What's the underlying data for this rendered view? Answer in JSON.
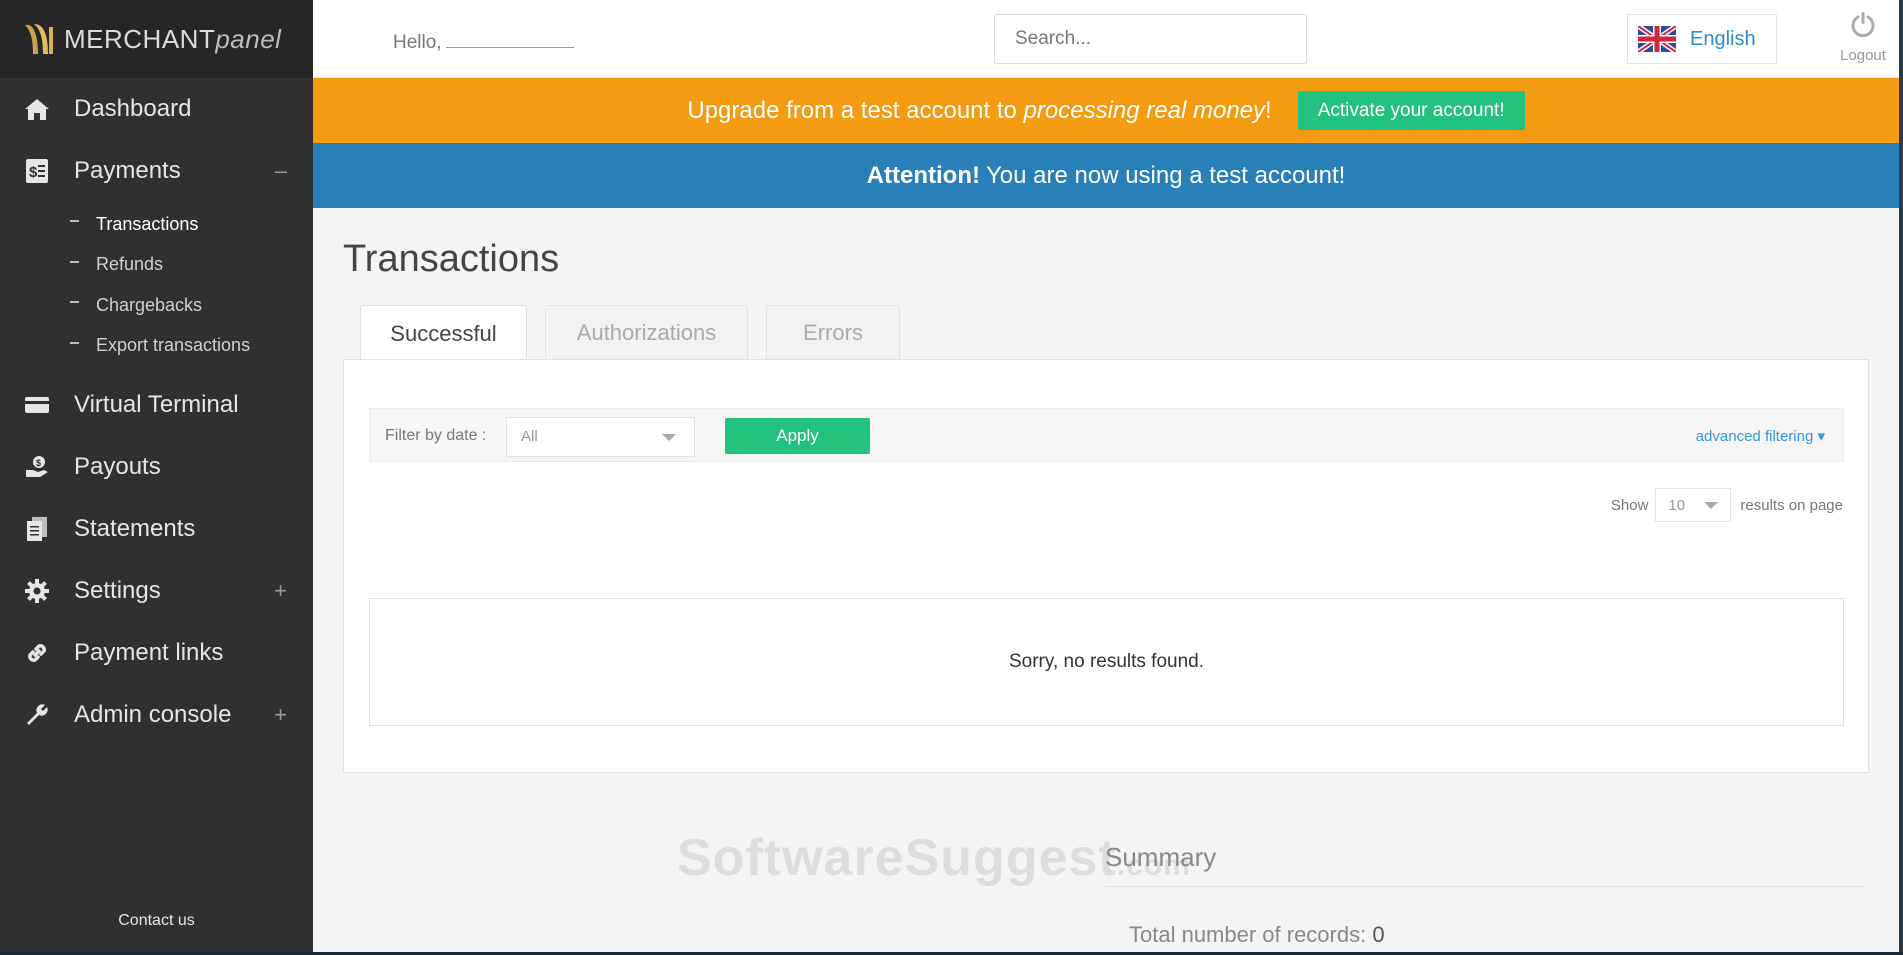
{
  "brand": {
    "name_main": "MERCHANT",
    "name_sub": "panel"
  },
  "sidebar": {
    "items": [
      {
        "label": "Dashboard",
        "icon": "home-icon",
        "expander": ""
      },
      {
        "label": "Payments",
        "icon": "invoice-icon",
        "expander": "–"
      },
      {
        "label": "Virtual Terminal",
        "icon": "credit-card-icon",
        "expander": ""
      },
      {
        "label": "Payouts",
        "icon": "hand-coin-icon",
        "expander": ""
      },
      {
        "label": "Statements",
        "icon": "documents-icon",
        "expander": ""
      },
      {
        "label": "Settings",
        "icon": "gear-icon",
        "expander": "+"
      },
      {
        "label": "Payment links",
        "icon": "link-icon",
        "expander": ""
      },
      {
        "label": "Admin console",
        "icon": "wrench-icon",
        "expander": "+"
      }
    ],
    "payments_sub": [
      "Transactions",
      "Refunds",
      "Chargebacks",
      "Export transactions"
    ],
    "contact": "Contact us"
  },
  "topbar": {
    "hello": "Hello,",
    "search_placeholder": "Search...",
    "language": "English",
    "logout": "Logout"
  },
  "banners": {
    "upgrade_prefix": "Upgrade from a test account to ",
    "upgrade_emphasis": "processing real money",
    "upgrade_suffix": "!",
    "activate_button": "Activate your account!",
    "attention_bold": "Attention!",
    "attention_text": "You are now using a test account!"
  },
  "main": {
    "title": "Transactions",
    "tabs": [
      "Successful",
      "Authorizations",
      "Errors"
    ],
    "active_tab": "Successful",
    "filter_label": "Filter by date :",
    "date_value": "All",
    "apply_button": "Apply",
    "advanced_filtering": "advanced filtering ▾",
    "show_label": "Show",
    "show_value": "10",
    "results_label": "results on page",
    "no_results": "Sorry, no results found."
  },
  "summary": {
    "title": "Summary",
    "total_label": "Total number of records:",
    "total_value": "0"
  },
  "watermark": {
    "main": "SoftwareSuggest",
    "suffix": ".com"
  },
  "colors": {
    "sidebar_bg": "#303030",
    "banner_orange": "#f39c12",
    "banner_blue": "#2980b9",
    "accent_green": "#22c17e",
    "link_blue": "#3498db"
  }
}
